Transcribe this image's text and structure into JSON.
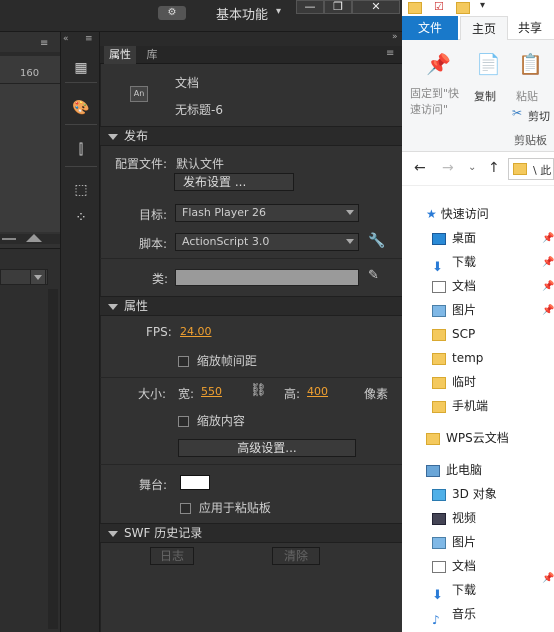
{
  "topbar": {
    "workspace": "基本功能",
    "workspace_arrow": "▾",
    "minimize": "—",
    "maximize": "❐",
    "close": "✕"
  },
  "left_ruler": {
    "tick": "160"
  },
  "panel_tabs": {
    "properties": "属性",
    "library": "库"
  },
  "doc": {
    "type": "文档",
    "name": "无标题-6",
    "icon_text": "An"
  },
  "publish": {
    "section": "发布",
    "profile_label": "配置文件:",
    "profile_value": "默认文件",
    "settings_button": "发布设置 ...",
    "target_label": "目标:",
    "target_value": "Flash Player 26",
    "script_label": "脚本:",
    "script_value": "ActionScript 3.0",
    "class_label": "类:"
  },
  "properties": {
    "section": "属性",
    "fps_label": "FPS:",
    "fps_value": "24.00",
    "scale_frame_label": "缩放帧间距",
    "size_label": "大小:",
    "width_label": "宽:",
    "width_value": "550",
    "height_label": "高:",
    "height_value": "400",
    "unit": "像素",
    "scale_content_label": "缩放内容",
    "advanced_button": "高级设置...",
    "stage_label": "舞台:",
    "stage_color": "#ffffff",
    "apply_paste_label": "应用于粘贴板"
  },
  "swf": {
    "section": "SWF 历史记录",
    "log_button": "日志",
    "clear_button": "清除"
  },
  "explorer": {
    "tabs": {
      "file": "文件",
      "home": "主页",
      "share": "共享"
    },
    "ribbon": {
      "pin": "固定到\"快\n速访问\"",
      "copy": "复制",
      "paste": "粘贴",
      "cut": "剪切",
      "clipboard": "剪贴板"
    },
    "nav": {
      "path": "\\ 此"
    },
    "quick_access": "快速访问",
    "items": [
      "桌面",
      "下载",
      "文档",
      "图片",
      "SCP",
      "temp",
      "临时",
      "手机端"
    ],
    "wps": "WPS云文档",
    "this_pc": "此电脑",
    "pc_items": [
      "3D 对象",
      "视频",
      "图片",
      "文档",
      "下载",
      "音乐"
    ]
  },
  "colors": {
    "accent_orange": "#f0a030",
    "explorer_blue": "#1979ca"
  }
}
